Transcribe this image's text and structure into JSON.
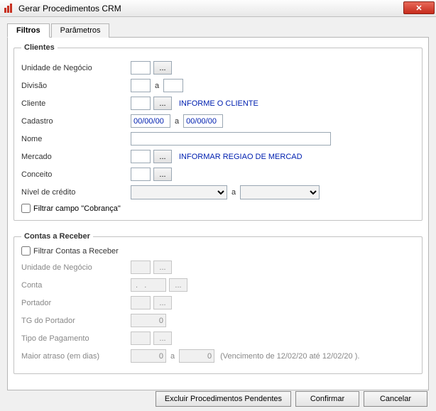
{
  "window": {
    "title": "Gerar Procedimentos CRM"
  },
  "tabs": {
    "filtros": "Filtros",
    "parametros": "Parâmetros"
  },
  "clientes": {
    "legend": "Clientes",
    "unidade_label": "Unidade de Negócio",
    "divisao_label": "Divisão",
    "divisao_sep": "a",
    "cliente_label": "Cliente",
    "cliente_info": "INFORME O CLIENTE",
    "cadastro_label": "Cadastro",
    "cadastro_de": "00/00/00",
    "cadastro_sep": "a",
    "cadastro_ate": "00/00/00",
    "nome_label": "Nome",
    "mercado_label": "Mercado",
    "mercado_info": "INFORMAR REGIAO DE MERCAD",
    "conceito_label": "Conceito",
    "nivel_label": "Nível de crédito",
    "nivel_sep": "a",
    "filtrar_cobranca": "Filtrar campo \"Cobrança\""
  },
  "contas": {
    "legend": "Contas a Receber",
    "filtrar": "Filtrar Contas a Receber",
    "unidade_label": "Unidade de Negócio",
    "conta_label": "Conta",
    "conta_value": " .   .",
    "portador_label": "Portador",
    "tg_label": "TG do Portador",
    "tg_value": "0",
    "tipo_label": "Tipo de Pagamento",
    "atraso_label": "Maior atraso (em dias)",
    "atraso_de": "0",
    "atraso_sep": "a",
    "atraso_ate": "0",
    "venc_text": "(Vencimento de  12/02/20  até  12/02/20 )."
  },
  "buttons": {
    "excluir": "Excluir Procedimentos Pendentes",
    "confirmar": "Confirmar",
    "cancelar": "Cancelar"
  },
  "glyphs": {
    "ellipsis": "...",
    "close": "✕"
  }
}
